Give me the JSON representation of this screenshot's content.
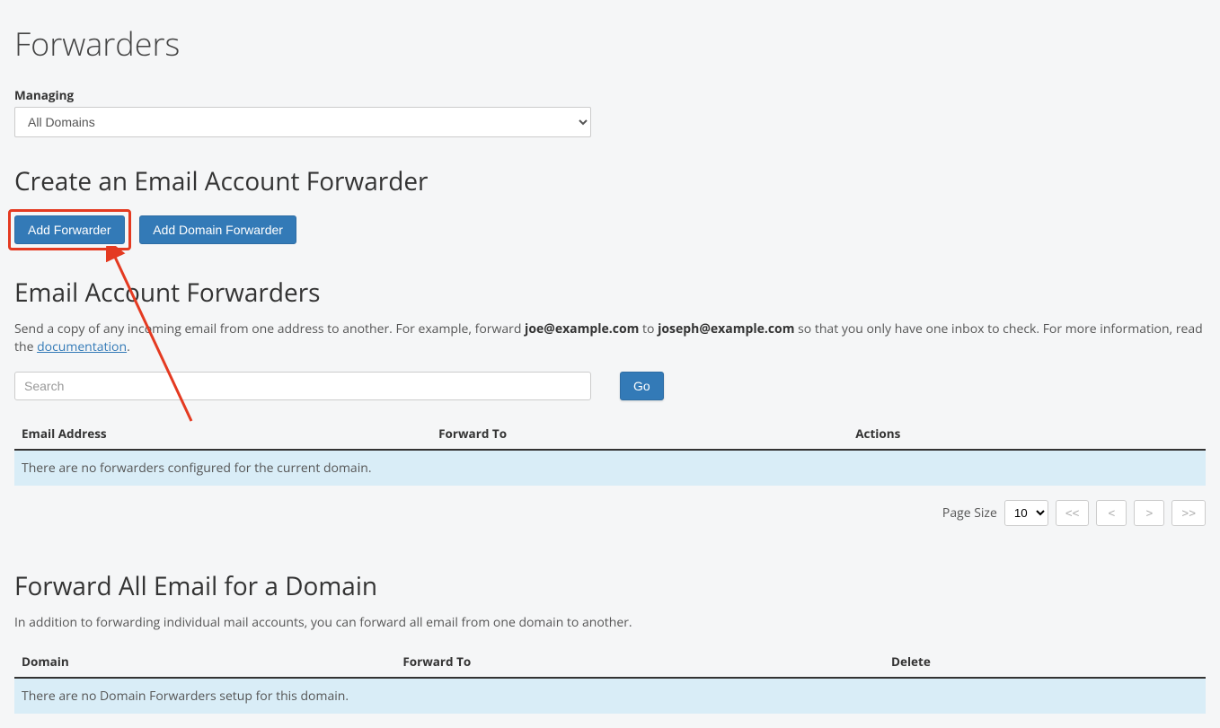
{
  "page": {
    "title": "Forwarders"
  },
  "managing": {
    "label": "Managing",
    "selected": "All Domains"
  },
  "create": {
    "heading": "Create an Email Account Forwarder",
    "add_forwarder": "Add Forwarder",
    "add_domain_forwarder": "Add Domain Forwarder"
  },
  "emailForwarders": {
    "heading": "Email Account Forwarders",
    "desc_prefix": "Send a copy of any incoming email from one address to another. For example, forward ",
    "example_from": "joe@example.com",
    "desc_mid": " to ",
    "example_to": "joseph@example.com",
    "desc_suffix": " so that you only have one inbox to check. For more information, read the ",
    "doc_link": "documentation",
    "desc_end": ".",
    "search_placeholder": "Search",
    "go": "Go",
    "cols": {
      "email": "Email Address",
      "forward_to": "Forward To",
      "actions": "Actions"
    },
    "empty": "There are no forwarders configured for the current domain."
  },
  "pager": {
    "page_size_label": "Page Size",
    "page_size_value": "10",
    "first": "<<",
    "prev": "<",
    "next": ">",
    "last": ">>"
  },
  "domainForward": {
    "heading": "Forward All Email for a Domain",
    "desc": "In addition to forwarding individual mail accounts, you can forward all email from one domain to another.",
    "cols": {
      "domain": "Domain",
      "forward_to": "Forward To",
      "delete": "Delete"
    },
    "empty": "There are no Domain Forwarders setup for this domain."
  }
}
